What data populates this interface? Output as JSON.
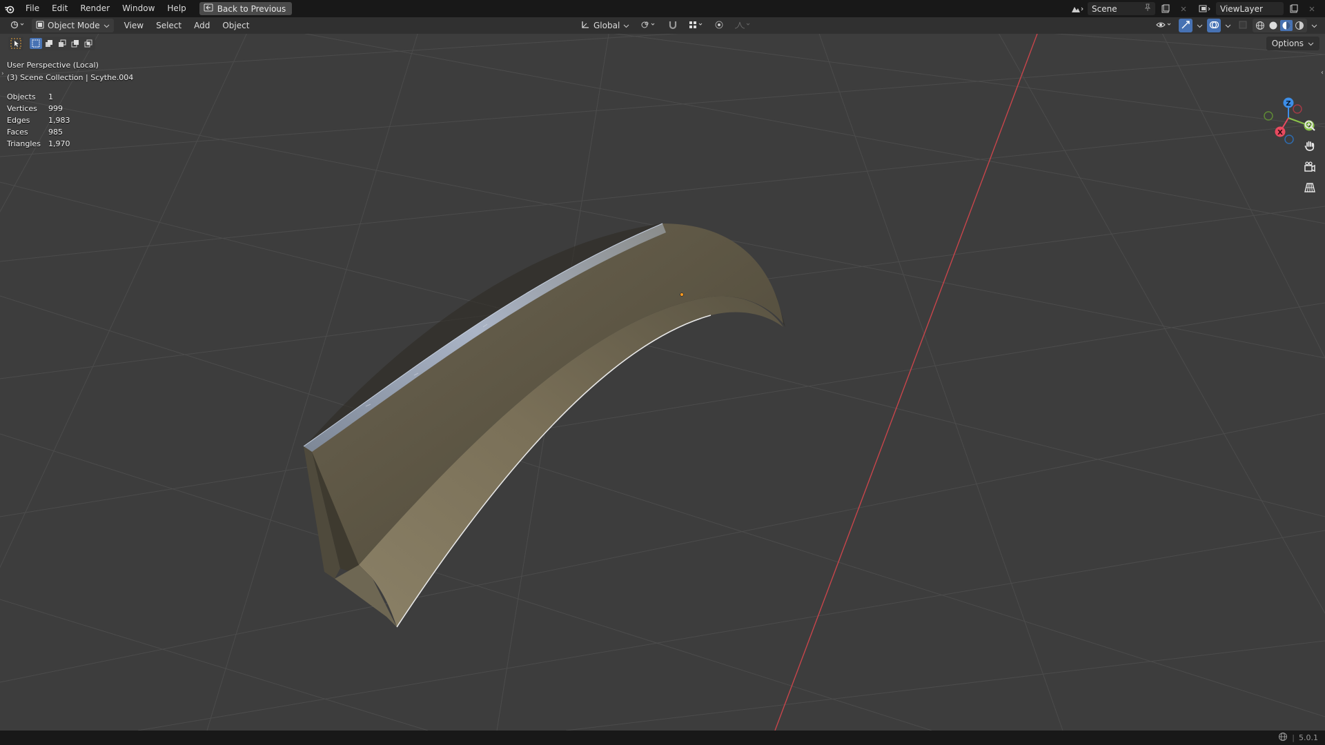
{
  "menubar": {
    "items": [
      "File",
      "Edit",
      "Render",
      "Window",
      "Help"
    ],
    "back_button": "Back to Previous",
    "scene_name": "Scene",
    "view_layer": "ViewLayer"
  },
  "viewport_header": {
    "mode": "Object Mode",
    "menus": [
      "View",
      "Select",
      "Add",
      "Object"
    ],
    "transform_orientation": "Global"
  },
  "viewport": {
    "perspective_label": "User Perspective (Local)",
    "collection_label": "(3) Scene Collection | Scythe.004",
    "options_label": "Options",
    "stats": [
      {
        "label": "Objects",
        "value": "1"
      },
      {
        "label": "Vertices",
        "value": "999"
      },
      {
        "label": "Edges",
        "value": "1,983"
      },
      {
        "label": "Faces",
        "value": "985"
      },
      {
        "label": "Triangles",
        "value": "1,970"
      }
    ],
    "gizmo": {
      "x_label": "X",
      "y_label": "Y",
      "z_label": "Z"
    }
  },
  "statusbar": {
    "version": "5.0.1"
  },
  "colors": {
    "background": "#3d3d3d",
    "grid": "#4e4e4e",
    "x_axis": "#c8454b",
    "accent": "#4772b3",
    "gizmo_x": "#e84a5f",
    "gizmo_y": "#8bc34a",
    "gizmo_z": "#3d8ee8"
  }
}
